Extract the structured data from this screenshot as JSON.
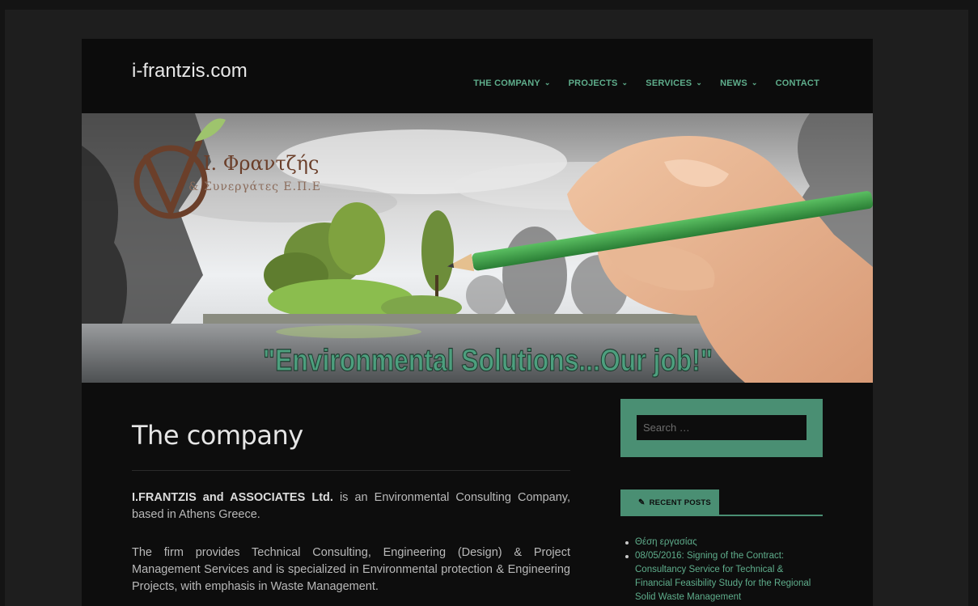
{
  "site": {
    "title": "i-frantzis.com"
  },
  "nav": {
    "items": [
      {
        "label": "THE COMPANY",
        "has_dropdown": true
      },
      {
        "label": "PROJECTS",
        "has_dropdown": true
      },
      {
        "label": "SERVICES",
        "has_dropdown": true
      },
      {
        "label": "NEWS",
        "has_dropdown": true
      },
      {
        "label": "CONTACT",
        "has_dropdown": false
      }
    ]
  },
  "banner": {
    "logo_line1": "Ι. Φραντζής",
    "logo_line2": "& Συνεργάτες Ε.Π.Ε",
    "slogan": "\"Environmental Solutions...Our job!\""
  },
  "content": {
    "title": "The company",
    "p1_bold": "I.FRANTZIS and ASSOCIATES Ltd.",
    "p1_rest": " is an Environmental Consulting Company, based in Athens Greece.",
    "p2": "The firm provides Technical Consulting, Engineering (Design) & Project Management Services and is specialized in Environmental protection & Engineering Projects, with emphasis in Waste Management."
  },
  "sidebar": {
    "search_placeholder": "Search …",
    "recent_posts_title": "RECENT POSTS",
    "recent_posts": [
      "Θέση εργασίας",
      "08/05/2016: Signing of the Contract: Consultancy Service for Technical & Financial Feasibility Study for the Regional Solid Waste Management"
    ]
  },
  "colors": {
    "accent": "#4a8f73",
    "link": "#5fae8c",
    "background": "#0d0d0d"
  }
}
